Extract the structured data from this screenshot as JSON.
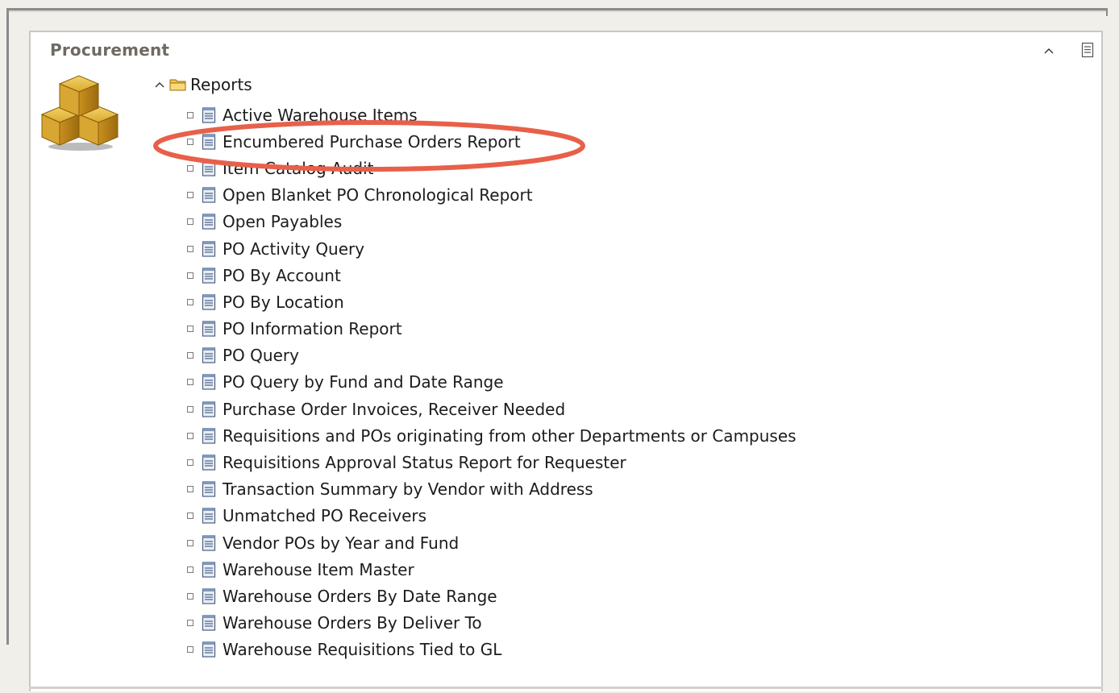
{
  "panel": {
    "title": "Procurement",
    "collapse_icon": "chevron-up-icon",
    "menu_icon": "page-menu-icon",
    "section_icon": "stacked-boxes-icon"
  },
  "tree": {
    "root_label": "Reports",
    "root_state": "expanded",
    "items": [
      {
        "label": "Active Warehouse Items"
      },
      {
        "label": "Encumbered Purchase Orders Report"
      },
      {
        "label": "Item Catalog Audit"
      },
      {
        "label": "Open Blanket PO Chronological Report"
      },
      {
        "label": "Open Payables"
      },
      {
        "label": "PO Activity Query"
      },
      {
        "label": "PO By Account"
      },
      {
        "label": "PO By Location"
      },
      {
        "label": "PO Information Report"
      },
      {
        "label": "PO Query"
      },
      {
        "label": "PO Query by Fund and Date Range"
      },
      {
        "label": "Purchase Order Invoices, Receiver Needed"
      },
      {
        "label": "Requisitions and POs originating from other Departments or Campuses"
      },
      {
        "label": "Requisitions Approval Status Report for Requester"
      },
      {
        "label": "Transaction Summary by Vendor with Address"
      },
      {
        "label": "Unmatched PO Receivers"
      },
      {
        "label": "Vendor POs by Year and Fund"
      },
      {
        "label": "Warehouse Item Master"
      },
      {
        "label": "Warehouse Orders By Date Range"
      },
      {
        "label": "Warehouse Orders By Deliver To"
      },
      {
        "label": "Warehouse Requisitions Tied to GL"
      }
    ]
  },
  "annotation": {
    "highlighted_item": "Encumbered Purchase Orders Report",
    "color": "#e8604a"
  },
  "colors": {
    "title_text": "#6d6a62",
    "background": "#f0efea",
    "panel": "#ffffff",
    "highlight": "#e8604a"
  }
}
